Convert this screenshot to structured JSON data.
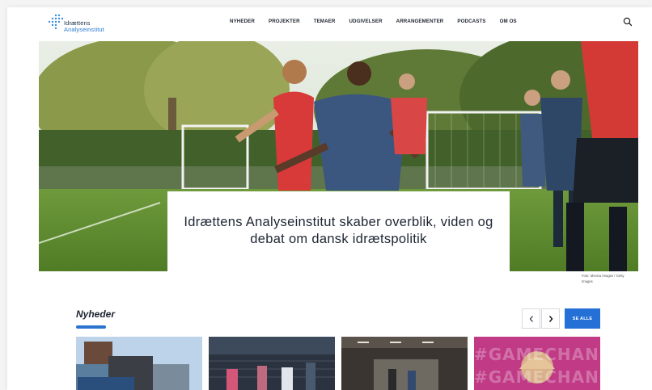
{
  "header": {
    "logo_line1": "Idrættens",
    "logo_line2": "Analyseinstitut",
    "nav": [
      "NYHEDER",
      "PROJEKTER",
      "TEMAER",
      "UDGIVELSER",
      "ARRANGEMENTER",
      "PODCASTS",
      "OM OS"
    ]
  },
  "hero": {
    "title": "Idrættens Analyseinstitut skaber overblik, viden og debat om dansk idrætspolitik",
    "photo_credit": "Foto: Monica Images / Getty Images"
  },
  "news": {
    "heading": "Nyheder",
    "see_all": "SE ALLE",
    "prev_icon": "chevron-left-icon",
    "next_icon": "chevron-right-icon",
    "card4_overlay": "#GAMECHANGE"
  },
  "colors": {
    "accent": "#2470d6",
    "text_dark": "#1e2633"
  }
}
